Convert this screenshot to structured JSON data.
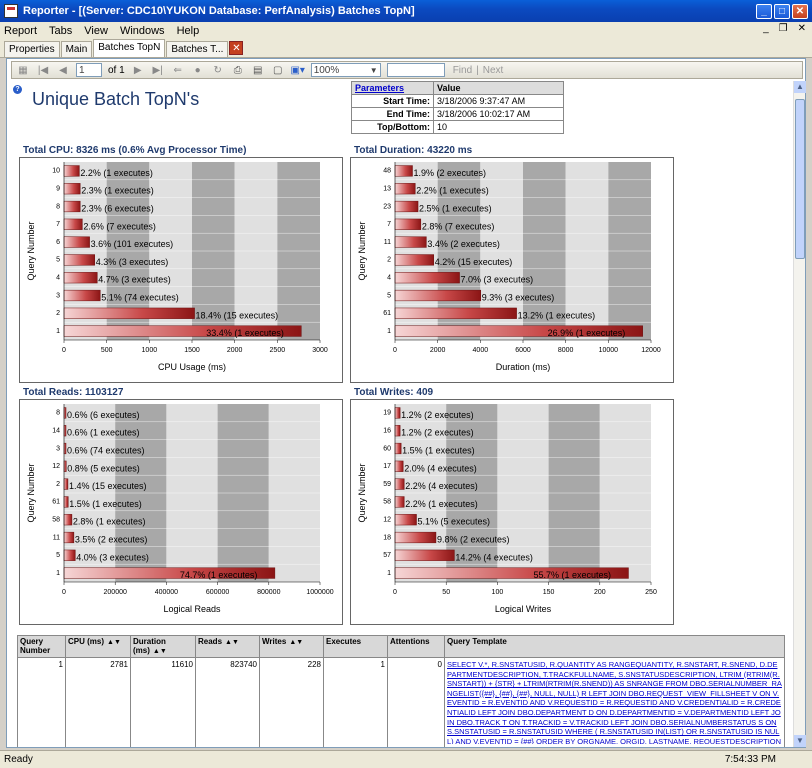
{
  "window": {
    "title": "Reporter - [(Server: CDC10\\YUKON Database: PerfAnalysis) Batches TopN]"
  },
  "menu": {
    "items": [
      "Report",
      "Tabs",
      "View",
      "Windows",
      "Help"
    ]
  },
  "tabs": [
    "Properties",
    "Main",
    "Batches TopN",
    "Batches T..."
  ],
  "toolbar": {
    "page": "1",
    "of_label": "of",
    "total": "1",
    "zoom": "100%",
    "find": "Find",
    "next": "Next"
  },
  "report": {
    "title": "Unique Batch TopN's",
    "params": {
      "header_name": "Parameters",
      "header_value": "Value",
      "rows": [
        {
          "label": "Start Time:",
          "value": "3/18/2006 9:37:47 AM"
        },
        {
          "label": "End Time:",
          "value": "3/18/2006 10:02:17 AM"
        },
        {
          "label": "Top/Bottom:",
          "value": "10"
        }
      ]
    }
  },
  "chart_data": [
    {
      "type": "bar",
      "title": "Total CPU: 8326 ms (0.6% Avg Processor Time)",
      "xlabel": "CPU Usage (ms)",
      "ylabel": "Query Number",
      "xlim": [
        0,
        3000
      ],
      "xticks": [
        "0",
        "500",
        "1000",
        "1500",
        "2000",
        "2500",
        "3000"
      ],
      "categories": [
        "10",
        "9",
        "8",
        "7",
        "6",
        "5",
        "4",
        "3",
        "2",
        "1"
      ],
      "values": [
        180,
        190,
        190,
        215,
        300,
        360,
        390,
        425,
        1530,
        2781
      ],
      "labels": [
        "2.2% (1 executes)",
        "2.3% (1 executes)",
        "2.3% (6 executes)",
        "2.6% (7 executes)",
        "3.6% (101 executes)",
        "4.3% (3 executes)",
        "4.7% (3 executes)",
        "5.1% (74 executes)",
        "18.4% (15 executes)",
        "33.4% (1 executes)"
      ]
    },
    {
      "type": "bar",
      "title": "Total Duration: 43220 ms",
      "xlabel": "Duration (ms)",
      "ylabel": "Query Number",
      "xlim": [
        0,
        12000
      ],
      "xticks": [
        "0",
        "2000",
        "4000",
        "6000",
        "8000",
        "10000",
        "12000"
      ],
      "categories": [
        "48",
        "13",
        "23",
        "7",
        "11",
        "2",
        "4",
        "5",
        "61",
        "1"
      ],
      "values": [
        820,
        950,
        1080,
        1210,
        1470,
        1815,
        3025,
        4020,
        5700,
        11610
      ],
      "labels": [
        "1.9% (2 executes)",
        "2.2% (1 executes)",
        "2.5% (1 executes)",
        "2.8% (7 executes)",
        "3.4% (2 executes)",
        "4.2% (15 executes)",
        "7.0% (3 executes)",
        "9.3% (3 executes)",
        "13.2% (1 executes)",
        "26.9% (1 executes)"
      ]
    },
    {
      "type": "bar",
      "title": "Total Reads: 1103127",
      "xlabel": "Logical Reads",
      "ylabel": "Query Number",
      "xlim": [
        0,
        1000000
      ],
      "xticks": [
        "0",
        "200000",
        "400000",
        "600000",
        "800000",
        "1000000"
      ],
      "categories": [
        "8",
        "14",
        "3",
        "12",
        "2",
        "61",
        "58",
        "11",
        "5",
        "1"
      ],
      "values": [
        6600,
        6600,
        6600,
        8800,
        15400,
        16500,
        30900,
        38600,
        44100,
        823740
      ],
      "labels": [
        "0.6% (6 executes)",
        "0.6% (1 executes)",
        "0.6% (74 executes)",
        "0.8% (5 executes)",
        "1.4% (15 executes)",
        "1.5% (1 executes)",
        "2.8% (1 executes)",
        "3.5% (2 executes)",
        "4.0% (3 executes)",
        "74.7% (1 executes)"
      ]
    },
    {
      "type": "bar",
      "title": "Total Writes: 409",
      "xlabel": "Logical Writes",
      "ylabel": "Query Number",
      "xlim": [
        0,
        250
      ],
      "xticks": [
        "0",
        "50",
        "100",
        "150",
        "200",
        "250"
      ],
      "categories": [
        "19",
        "16",
        "60",
        "17",
        "59",
        "58",
        "12",
        "18",
        "57",
        "1"
      ],
      "values": [
        5,
        5,
        6,
        8,
        9,
        9,
        21,
        40,
        58,
        228
      ],
      "labels": [
        "1.2% (2 executes)",
        "1.2% (2 executes)",
        "1.5% (1 executes)",
        "2.0% (4 executes)",
        "2.2% (4 executes)",
        "2.2% (1 executes)",
        "5.1% (5 executes)",
        "9.8% (2 executes)",
        "14.2% (4 executes)",
        "55.7% (1 executes)"
      ]
    }
  ],
  "grid": {
    "headers": [
      "Query Number",
      "CPU (ms)",
      "Duration (ms)",
      "Reads",
      "Writes",
      "Executes",
      "Attentions",
      "Query Template"
    ],
    "rows": [
      {
        "query": "1",
        "cpu": "2781",
        "duration": "11610",
        "reads": "823740",
        "writes": "228",
        "executes": "1",
        "attentions": "0",
        "template": "SELECT V.*, R.SNSTATUSID, R.QUANTITY AS RANGEQUANTITY, R.SNSTART, R.SNEND, D.DEPARTMENTDESCRIPTION, T.TRACKFULLNAME, S.SNSTATUSDESCRIPTION, LTRIM (RTRIM(R.SNSTART)) + {STR} + LTRIM(RTRIM(R.SNEND)) AS SNRANGE FROM DBO.SERIALNUMBER_RANGELIST({##}, {##}, {##}, NULL, NULL) R LEFT JOIN DBO.REQUEST_VIEW_FILLSHEET V ON V.EVENTID = R.EVENTID AND V.REQUESTID = R.REQUESTID AND V.CREDENTIALID = R.CREDENTIALID LEFT JOIN DBO.DEPARTMENT D ON D.DEPARTMENTID = V.DEPARTMENTID LEFT JOIN DBO.TRACK T ON T.TRACKID = V.TRACKID LEFT JOIN DBO.SERIALNUMBERSTATUS S ON S.SNSTATUSID = R.SNSTATUSID WHERE ( R.SNSTATUSID IN(LIST) OR R.SNSTATUSID IS NULL) AND V.EVENTID = {##} ORDER BY ORGNAME, ORGID, LASTNAME, REQUESTDESCRIPTIONPERSON, PERSONID,"
      }
    ]
  },
  "status": {
    "text": "Ready",
    "time": "7:54:33 PM"
  }
}
